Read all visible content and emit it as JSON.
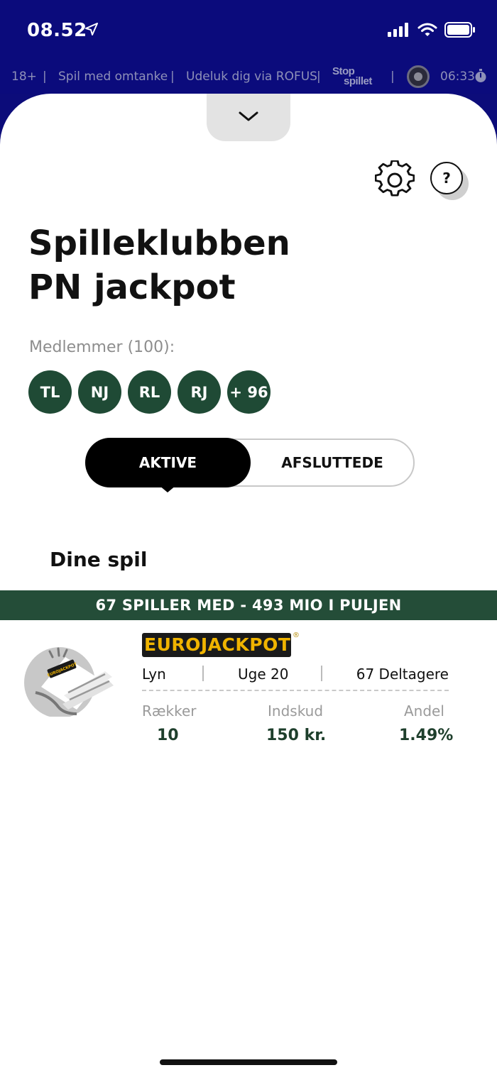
{
  "status_bar": {
    "time": "08.52"
  },
  "rg_bar": {
    "age": "18+",
    "item1": "Spil med omtanke",
    "item2": "Udeluk dig via ROFUS",
    "stop_line1": "Stop",
    "stop_line2": "spillet",
    "session_time": "06:33"
  },
  "icons": {
    "collapse": "chevron-down-icon",
    "settings": "gear-icon",
    "help": "question-icon",
    "timer": "stopwatch-icon",
    "location": "location-arrow-icon",
    "signal": "cellular-signal-icon",
    "wifi": "wifi-icon",
    "battery": "battery-icon",
    "ticket": "lottery-ticket-icon",
    "crest": "crest-icon"
  },
  "header": {
    "help_label": "?",
    "title_line1": "Spilleklubben",
    "title_line2": "PN jackpot"
  },
  "members": {
    "label": "Medlemmer (100):",
    "avatars": [
      "TL",
      "NJ",
      "RL",
      "RJ",
      "+ 96"
    ]
  },
  "tabs": {
    "active": "AKTIVE",
    "finished": "AFSLUTTEDE"
  },
  "section_title": "Dine spil",
  "game": {
    "banner": "67 SPILLER MED - 493 MIO I PULJEN",
    "logo_text": "EUROJACKPOT",
    "logo_reg": "®",
    "ticket_label": "EUROJACKPOT",
    "type": "Lyn",
    "week": "Uge 20",
    "participants": "67 Deltagere",
    "stats": {
      "rows_label": "Rækker",
      "rows_value": "10",
      "stake_label": "Indskud",
      "stake_value": "150 kr.",
      "share_label": "Andel",
      "share_value": "1.49%"
    }
  },
  "colors": {
    "navy": "#0b0b7c",
    "club_green": "#244d38",
    "avatar_green": "#1f4a35",
    "logo_gold": "#f0b400"
  }
}
